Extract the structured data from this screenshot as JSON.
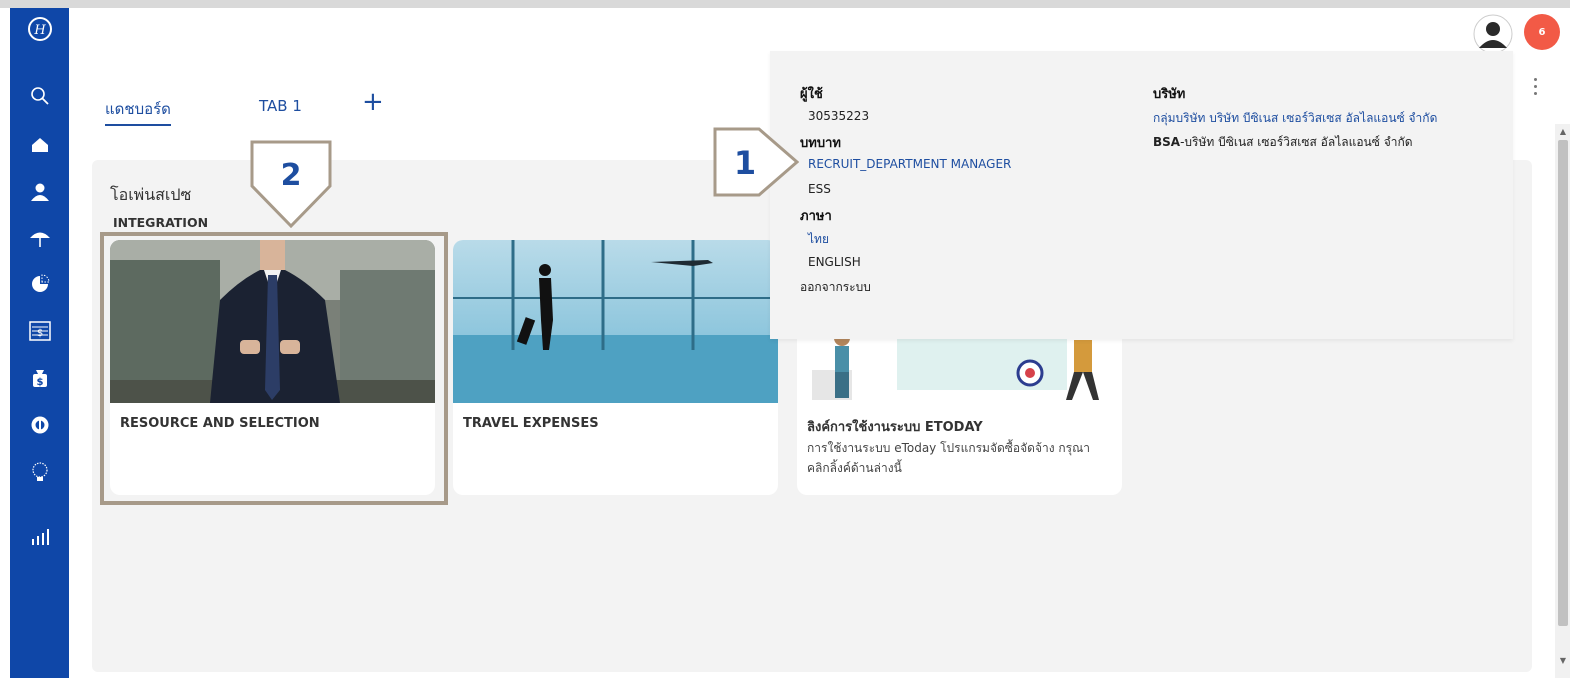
{
  "header": {
    "notification_count": "6"
  },
  "tabs": [
    {
      "label": "แดชบอร์ด"
    },
    {
      "label": "TAB 1"
    }
  ],
  "tab_add_label": "+",
  "workspace": {
    "title": "โอเพ่นสเปซ",
    "subtitle": "INTEGRATION",
    "cards": [
      {
        "title": "RESOURCE AND SELECTION",
        "description": ""
      },
      {
        "title": "TRAVEL EXPENSES",
        "description": ""
      },
      {
        "title": "ลิงค์การใช้งานระบบ ETODAY",
        "description": "การใช้งานระบบ eToday โปรแกรมจัดซื้อจัดจ้าง กรุณาคลิกลิ้งค์ด้านล่างนี้"
      }
    ]
  },
  "annotations": {
    "marker1": "1",
    "marker2": "2"
  },
  "dropdown": {
    "user_heading": "ผู้ใช้",
    "user_id": "30535223",
    "role_heading": "บทบาท",
    "roles": [
      "RECRUIT_DEPARTMENT MANAGER",
      "ESS"
    ],
    "language_heading": "ภาษา",
    "languages": [
      "ไทย",
      "ENGLISH"
    ],
    "logout": "ออกจากระบบ",
    "company_heading": "บริษัท",
    "companies": [
      "กลุ่มบริษัท บริษัท บีซิเนส เซอร์วิสเซส อัลไลแอนซ์ จำกัด"
    ],
    "company_code": "BSA",
    "company_name": "-บริษัท บีซิเนส เซอร์วิสเซส อัลไลแอนซ์ จำกัด"
  },
  "sidebar_icons": [
    "logo-icon",
    "search-icon",
    "home-icon",
    "user-icon",
    "umbrella-icon",
    "pie-chart-icon",
    "payroll-icon",
    "money-bag-icon",
    "coin-icon",
    "idea-bulb-icon",
    "bar-chart-icon"
  ],
  "colors": {
    "sidebar": "#0f47a8",
    "accent": "#1e4ea0",
    "badge": "#f25a46",
    "annotation": "#a79a89",
    "annotation_number": "#1e4ea0"
  }
}
